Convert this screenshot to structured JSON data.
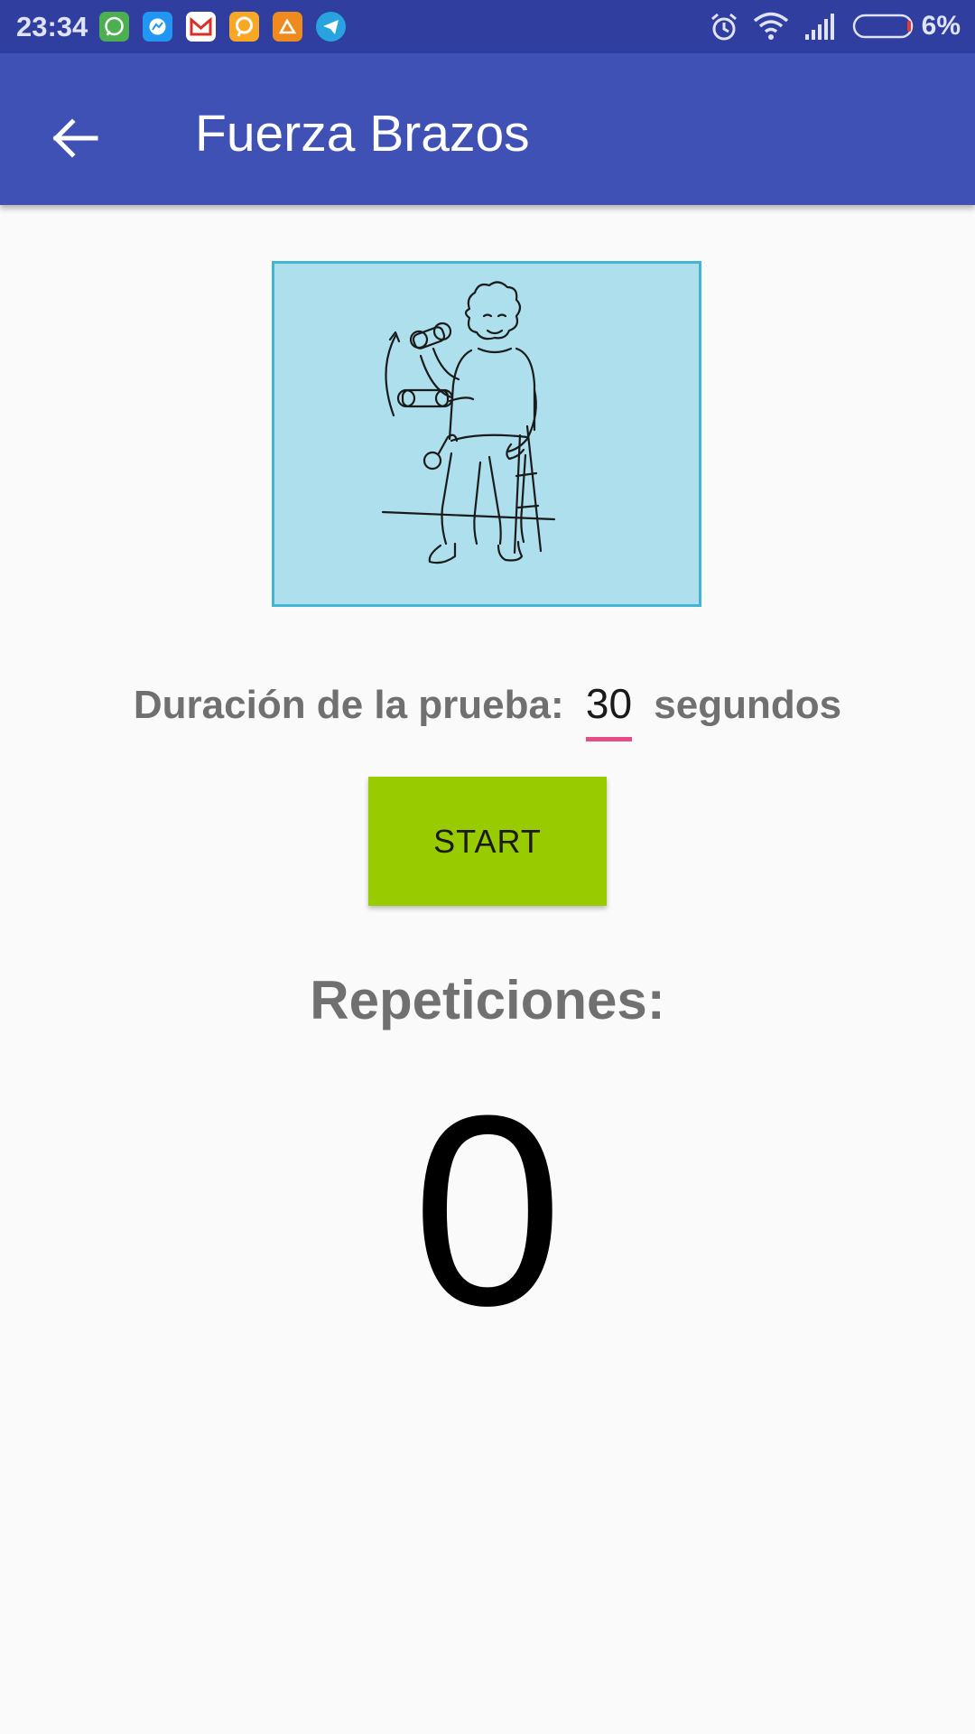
{
  "status_bar": {
    "time": "23:34",
    "battery_percent": "6%",
    "notification_icons": [
      "whatsapp-icon",
      "messenger-icon",
      "gmail-icon",
      "chat-bubble-icon",
      "app-icon",
      "telegram-icon"
    ],
    "system_icons": [
      "alarm-icon",
      "wifi-icon",
      "signal-icon",
      "battery-icon"
    ]
  },
  "app_bar": {
    "title": "Fuerza Brazos",
    "back_icon": "arrow-back-icon",
    "color": "#3f51b5"
  },
  "exercise": {
    "image_description_icon": "arm-curl-illustration-icon",
    "duration_label": "Duración de la prueba:",
    "duration_value": "30",
    "duration_unit": "segundos"
  },
  "actions": {
    "start_label": "START",
    "start_color": "#99cc00"
  },
  "results": {
    "reps_label": "Repeticiones:",
    "reps_count": "0"
  }
}
